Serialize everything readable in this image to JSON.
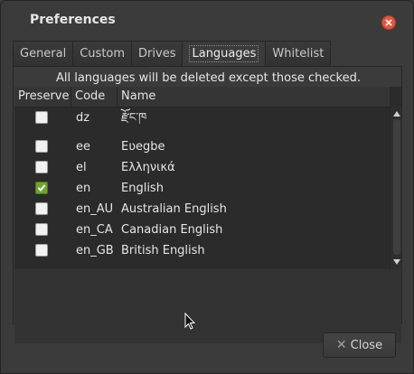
{
  "window": {
    "title": "Preferences"
  },
  "tabs": [
    {
      "label": "General",
      "active": false
    },
    {
      "label": "Custom",
      "active": false
    },
    {
      "label": "Drives",
      "active": false
    },
    {
      "label": "Languages",
      "active": true
    },
    {
      "label": "Whitelist",
      "active": false
    }
  ],
  "languages": {
    "notice": "All languages will be deleted except those checked.",
    "columns": {
      "preserve": "Preserve",
      "code": "Code",
      "name": "Name"
    },
    "rows": [
      {
        "code": "dz",
        "name": "རྫོང་ཁ",
        "checked": false
      },
      {
        "code": "ee",
        "name": "Eʋegbe",
        "checked": false
      },
      {
        "code": "el",
        "name": "Ελληνικά",
        "checked": false
      },
      {
        "code": "en",
        "name": "English",
        "checked": true
      },
      {
        "code": "en_AU",
        "name": "Australian English",
        "checked": false
      },
      {
        "code": "en_CA",
        "name": "Canadian English",
        "checked": false
      },
      {
        "code": "en_GB",
        "name": "British English",
        "checked": false
      }
    ]
  },
  "buttons": {
    "close_label": "Close"
  },
  "colors": {
    "accent_check": "#6fa52c",
    "close_red": "#e8543a",
    "bg": "#3b3b3b"
  }
}
